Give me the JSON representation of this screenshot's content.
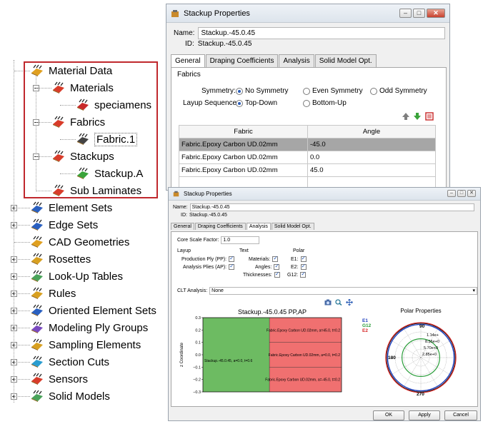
{
  "tree": {
    "items": [
      {
        "label": "Material Data",
        "icon": "material-data-icon"
      },
      {
        "label": "Materials",
        "icon": "materials-icon"
      },
      {
        "label": "speciamens",
        "icon": "specimen-material-icon"
      },
      {
        "label": "Fabrics",
        "icon": "fabrics-icon"
      },
      {
        "label": "Fabric.1",
        "icon": "fabric-item-icon"
      },
      {
        "label": "Stackups",
        "icon": "stackups-icon"
      },
      {
        "label": "Stackup.A",
        "icon": "stackup-item-icon"
      },
      {
        "label": "Sub Laminates",
        "icon": "sub-laminates-icon"
      },
      {
        "label": "Element Sets",
        "icon": "element-sets-icon"
      },
      {
        "label": "Edge Sets",
        "icon": "edge-sets-icon"
      },
      {
        "label": "CAD Geometries",
        "icon": "cad-geometries-icon"
      },
      {
        "label": "Rosettes",
        "icon": "rosettes-icon"
      },
      {
        "label": "Look-Up Tables",
        "icon": "look-up-tables-icon"
      },
      {
        "label": "Rules",
        "icon": "rules-icon"
      },
      {
        "label": "Oriented Element Sets",
        "icon": "oriented-element-sets-icon"
      },
      {
        "label": "Modeling Ply Groups",
        "icon": "modeling-ply-groups-icon"
      },
      {
        "label": "Sampling Elements",
        "icon": "sampling-elements-icon"
      },
      {
        "label": "Section Cuts",
        "icon": "section-cuts-icon"
      },
      {
        "label": "Sensors",
        "icon": "sensors-icon"
      },
      {
        "label": "Solid Models",
        "icon": "solid-models-icon"
      }
    ],
    "highlight_color": "#c0282d"
  },
  "dialog1": {
    "title": "Stackup Properties",
    "name_label": "Name:",
    "name_value": "Stackup.-45.0.45",
    "id_label": "ID:",
    "id_value": "Stackup.-45.0.45",
    "tabs": [
      "General",
      "Draping Coefficients",
      "Analysis",
      "Solid Model Opt."
    ],
    "fabrics_group": "Fabrics",
    "symmetry_label": "Symmetry:",
    "symmetry_options": [
      "No Symmetry",
      "Even Symmetry",
      "Odd Symmetry"
    ],
    "layup_label": "Layup Sequence:",
    "layup_options": [
      "Top-Down",
      "Bottom-Up"
    ],
    "table": {
      "headers": [
        "Fabric",
        "Angle"
      ],
      "rows": [
        [
          "Fabric.Epoxy Carbon UD.02mm",
          "-45.0"
        ],
        [
          "Fabric.Epoxy Carbon UD.02mm",
          "0.0"
        ],
        [
          "Fabric.Epoxy Carbon UD.02mm",
          "45.0"
        ]
      ]
    }
  },
  "dialog2": {
    "title": "Stackup Properties",
    "name_label": "Name:",
    "name_value": "Stackup.-45.0.45",
    "id_label": "ID:",
    "id_value": "Stackup.-45.0.45",
    "tabs": [
      "General",
      "Draping Coefficients",
      "Analysis",
      "Solid Model Opt."
    ],
    "core_scale_label": "Core Scale Factor:",
    "core_scale_value": "1.0",
    "layup_group": "Layup",
    "layup_checks": [
      "Production Ply (PP):",
      "Analysis Plies (AP):"
    ],
    "text_group": "Text",
    "text_checks": [
      "Materials:",
      "Angles:",
      "Thicknesses:"
    ],
    "polar_group": "Polar",
    "polar_checks": [
      "E1:",
      "E2:",
      "G12:"
    ],
    "clt_label": "CLT Analysis:",
    "clt_value": "None",
    "buttons": [
      "OK",
      "Apply",
      "Cancel"
    ]
  },
  "chart_data": [
    {
      "type": "bar",
      "title": "Stackup.-45.0.45 PP,AP",
      "ylabel": "z Coordinate",
      "ylim": [
        -0.3,
        0.3
      ],
      "yticks": [
        "0.3",
        "0.2",
        "0.1",
        "0.0",
        "−0.1",
        "−0.2",
        "−0.3"
      ],
      "left_block": {
        "label": "Stackup.-45.0.45, a=0.0, t=0.6",
        "z_bottom": -0.3,
        "z_top": 0.3,
        "color": "#6dbb62"
      },
      "layers": [
        {
          "label": "Fabric.Epoxy Carbon UD.02mm, a=45.0, t=0.2",
          "z_bottom": 0.1,
          "z_top": 0.3
        },
        {
          "label": "Fabric.Epoxy Carbon UD.02mm, a=0.0, t=0.2",
          "z_bottom": -0.1,
          "z_top": 0.1
        },
        {
          "label": "Fabric.Epoxy Carbon UD.02mm, a=-45.0, t=0.2",
          "z_bottom": -0.3,
          "z_top": -0.1
        }
      ],
      "layer_color": "#f07070"
    },
    {
      "type": "polar",
      "title": "Polar Properties",
      "legend": [
        {
          "name": "E1",
          "color": "#1f3fbf"
        },
        {
          "name": "G12",
          "color": "#2a9d3a"
        },
        {
          "name": "E2",
          "color": "#d62728"
        }
      ],
      "angle_labels": [
        "90",
        "180",
        "270"
      ],
      "radial_labels": [
        "1.14e+",
        "8.55e+0",
        "5.70e+0",
        "2.85e+0"
      ]
    }
  ]
}
